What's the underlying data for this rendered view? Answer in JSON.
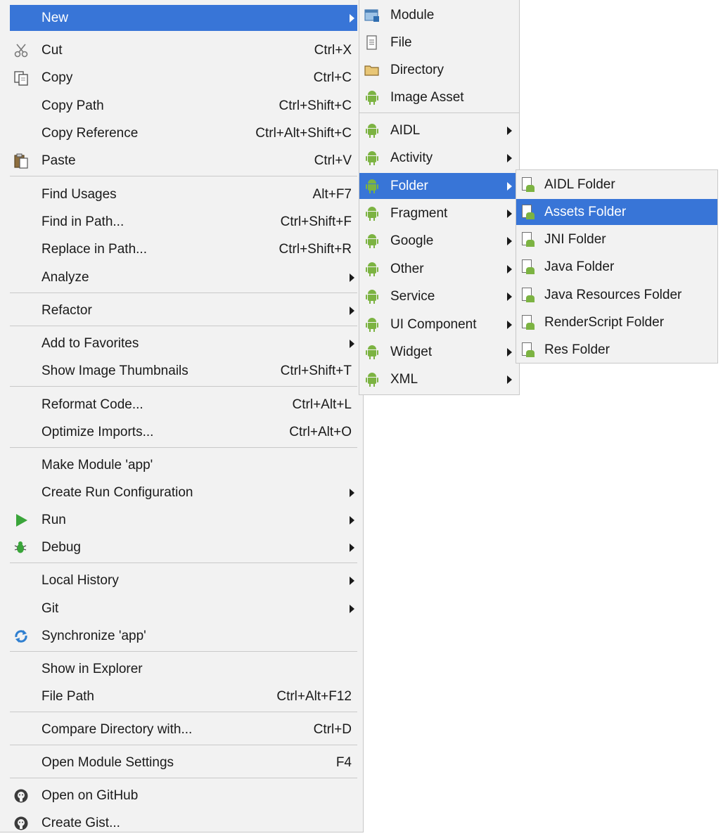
{
  "main_menu": {
    "items": [
      {
        "label": "New",
        "shortcut": "",
        "submenu": true,
        "highlighted": true
      },
      {
        "label": "Cut",
        "shortcut": "Ctrl+X",
        "icon": "scissors-icon"
      },
      {
        "label": "Copy",
        "shortcut": "Ctrl+C",
        "icon": "copy-icon"
      },
      {
        "label": "Copy Path",
        "shortcut": "Ctrl+Shift+C"
      },
      {
        "label": "Copy Reference",
        "shortcut": "Ctrl+Alt+Shift+C"
      },
      {
        "label": "Paste",
        "shortcut": "Ctrl+V",
        "icon": "paste-icon"
      },
      {
        "label": "Find Usages",
        "shortcut": "Alt+F7"
      },
      {
        "label": "Find in Path...",
        "shortcut": "Ctrl+Shift+F"
      },
      {
        "label": "Replace in Path...",
        "shortcut": "Ctrl+Shift+R"
      },
      {
        "label": "Analyze",
        "shortcut": "",
        "submenu": true
      },
      {
        "label": "Refactor",
        "shortcut": "",
        "submenu": true
      },
      {
        "label": "Add to Favorites",
        "shortcut": "",
        "submenu": true
      },
      {
        "label": "Show Image Thumbnails",
        "shortcut": "Ctrl+Shift+T"
      },
      {
        "label": "Reformat Code...",
        "shortcut": "Ctrl+Alt+L"
      },
      {
        "label": "Optimize Imports...",
        "shortcut": "Ctrl+Alt+O"
      },
      {
        "label": "Make Module 'app'",
        "shortcut": ""
      },
      {
        "label": "Create Run Configuration",
        "shortcut": "",
        "submenu": true
      },
      {
        "label": "Run",
        "shortcut": "",
        "submenu": true,
        "icon": "run-icon"
      },
      {
        "label": "Debug",
        "shortcut": "",
        "submenu": true,
        "icon": "debug-icon"
      },
      {
        "label": "Local History",
        "shortcut": "",
        "submenu": true
      },
      {
        "label": "Git",
        "shortcut": "",
        "submenu": true
      },
      {
        "label": "Synchronize 'app'",
        "shortcut": "",
        "icon": "synchronize-icon"
      },
      {
        "label": "Show in Explorer",
        "shortcut": ""
      },
      {
        "label": "File Path",
        "shortcut": "Ctrl+Alt+F12"
      },
      {
        "label": "Compare Directory with...",
        "shortcut": "Ctrl+D"
      },
      {
        "label": "Open Module Settings",
        "shortcut": "F4"
      },
      {
        "label": "Open on GitHub",
        "shortcut": "",
        "icon": "github-icon"
      },
      {
        "label": "Create Gist...",
        "shortcut": "",
        "icon": "github-icon"
      }
    ]
  },
  "new_submenu": {
    "items": [
      {
        "label": "Module",
        "icon": "module-icon"
      },
      {
        "label": "File",
        "icon": "file-icon"
      },
      {
        "label": "Directory",
        "icon": "directory-icon"
      },
      {
        "label": "Image Asset",
        "icon": "android-icon"
      },
      {
        "label": "AIDL",
        "icon": "android-icon",
        "submenu": true
      },
      {
        "label": "Activity",
        "icon": "android-icon",
        "submenu": true
      },
      {
        "label": "Folder",
        "icon": "android-icon",
        "submenu": true,
        "highlighted": true
      },
      {
        "label": "Fragment",
        "icon": "android-icon",
        "submenu": true
      },
      {
        "label": "Google",
        "icon": "android-icon",
        "submenu": true
      },
      {
        "label": "Other",
        "icon": "android-icon",
        "submenu": true
      },
      {
        "label": "Service",
        "icon": "android-icon",
        "submenu": true
      },
      {
        "label": "UI Component",
        "icon": "android-icon",
        "submenu": true
      },
      {
        "label": "Widget",
        "icon": "android-icon",
        "submenu": true
      },
      {
        "label": "XML",
        "icon": "android-icon",
        "submenu": true
      }
    ]
  },
  "folder_submenu": {
    "items": [
      {
        "label": "AIDL Folder",
        "icon": "android-folder-icon"
      },
      {
        "label": "Assets Folder",
        "icon": "android-folder-icon",
        "highlighted": true
      },
      {
        "label": "JNI Folder",
        "icon": "android-folder-icon"
      },
      {
        "label": "Java Folder",
        "icon": "android-folder-icon"
      },
      {
        "label": "Java Resources Folder",
        "icon": "android-folder-icon"
      },
      {
        "label": "RenderScript Folder",
        "icon": "android-folder-icon"
      },
      {
        "label": "Res Folder",
        "icon": "android-folder-icon"
      }
    ]
  },
  "colors": {
    "menu_background": "#f2f2f2",
    "highlight": "#3875d7",
    "android_green": "#7cb342",
    "separator": "#c9c9c9"
  }
}
